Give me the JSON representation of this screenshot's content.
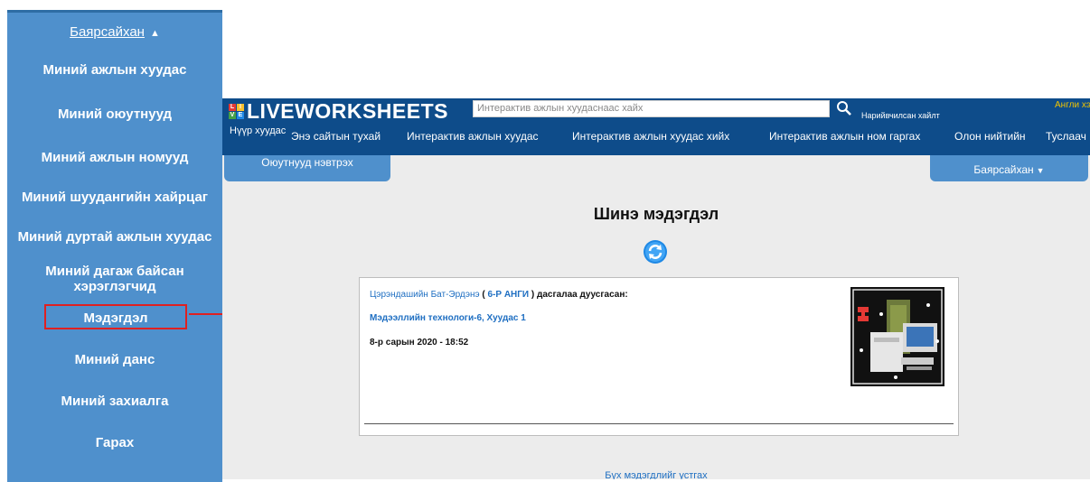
{
  "left_menu": {
    "user_name": "Баярсайхан",
    "user_caret": "▲",
    "items": [
      "Миний ажлын хуудас",
      "Миний оюутнууд",
      "Миний ажлын номууд",
      "Миний шуудангийн хайрцаг",
      "Миний дуртай ажлын хуудас",
      "Миний дагаж байсан хэрэглэгчид",
      "Мэдэгдэл",
      "Миний данс",
      "Миний захиалга",
      "Гарах"
    ]
  },
  "site": {
    "logo_letters": [
      "L",
      "I",
      "V",
      "E"
    ],
    "logo_text": "LIVEWORKSHEETS",
    "search_placeholder": "Интерактив ажлын хуудаснаас хайх",
    "advanced_search": "Нарийвчилсан хайлт",
    "language": "Англи хэл",
    "nav": [
      "Нүүр хуудас",
      "Энэ сайтын тухай",
      "Интерактив ажлын хуудас",
      "Интерактив ажлын хуудас хийх",
      "Интерактив ажлын ном гаргах",
      "Олон нийтийн",
      "Туслаач"
    ],
    "tab_students_login": "Оюутнууд нэвтрэх",
    "tab_user": "Баярсайхан",
    "tab_user_caret": "▼"
  },
  "page": {
    "title": "Шинэ мэдэгдэл",
    "notification": {
      "student_name": "Цэрэндашийн Бат-Эрдэнэ",
      "class_open": " ( ",
      "class_name": "6-Р АНГИ",
      "class_close": " ) ",
      "action_text": "дасгалаа дуусгасан:",
      "worksheet": "Мэдээллийн технологи-6, Хуудас 1",
      "date": "8-р сарын 2020 - 18:52"
    },
    "delete_all": "Бүх мэдэгдлийг устгах"
  },
  "colors": {
    "menu_blue": "#4f90cc",
    "header_navy": "#0e4c8a",
    "highlight_red": "#e02020",
    "link_blue": "#1f6fc2"
  },
  "icons": [
    "search-icon",
    "refresh-icon",
    "caret-up-icon",
    "caret-down-icon",
    "worksheet-thumbnail"
  ]
}
